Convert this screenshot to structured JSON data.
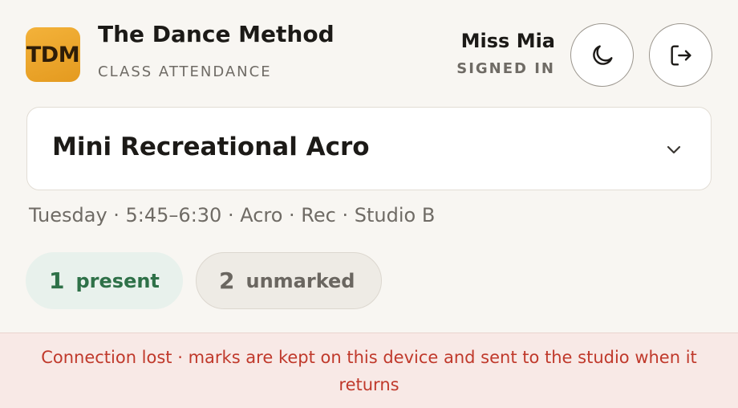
{
  "app": {
    "logo_text": "TDM",
    "title": "The Dance Method",
    "subtitle": "CLASS ATTENDANCE"
  },
  "user": {
    "name": "Miss Mia",
    "status": "SIGNED IN"
  },
  "header_buttons": {
    "theme_icon": "moon-icon",
    "signout_icon": "sign-out-icon"
  },
  "class_select": {
    "selected": "Mini Recreational Acro",
    "icon": "chevron-down-icon"
  },
  "class_meta": "Tuesday · 5:45–6:30 · Acro · Rec · Studio B",
  "counts": {
    "present": {
      "count": "1",
      "label": "present"
    },
    "unmarked": {
      "count": "2",
      "label": "unmarked"
    }
  },
  "banner": {
    "message": "Connection lost · marks are kept on this device and sent to the studio when it returns"
  },
  "colors": {
    "accent": "#e9a22a",
    "present": "#2e7148",
    "error": "#c0392b",
    "background": "#f8f6f2"
  }
}
